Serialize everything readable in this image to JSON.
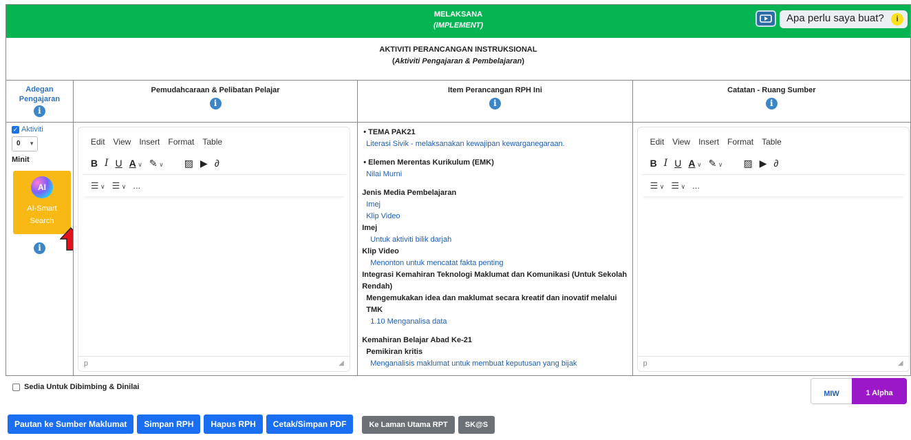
{
  "header": {
    "title": "MELAKSANA",
    "subtitle": "(IMPLEMENT)",
    "help_label": "Apa perlu saya buat?",
    "help_badge": "i"
  },
  "section": {
    "title": "AKTIVITI PERANCANGAN INSTRUKSIONAL",
    "subtitle_open": "(",
    "subtitle_italic": "Aktiviti Pengajaran & Pembelajaran",
    "subtitle_close": ")"
  },
  "columns": {
    "col1_line1": "Adegan",
    "col1_line2": "Pengajaran",
    "col2": "Pemudahcaraan & Pelibatan Pelajar",
    "col3": "Item Perancangan RPH Ini",
    "col4": "Catatan - Ruang Sumber",
    "info_glyph": "i"
  },
  "left_panel": {
    "aktiviti_label": "Aktiviti",
    "aktiviti_checked": true,
    "minute_value": "0",
    "minit_label": "Minit",
    "ai_logo_text": "AI",
    "ai_line1": "AI-Smart",
    "ai_line2": "Search"
  },
  "editor": {
    "menu": [
      "Edit",
      "View",
      "Insert",
      "Format",
      "Table"
    ],
    "status_text": "p",
    "more": "..."
  },
  "rph_items": [
    {
      "text": "TEMA PAK21",
      "style": "bullet-bold"
    },
    {
      "text": "Literasi Sivik - melaksanakan kewajipan kewarganegaraan.",
      "style": "link"
    },
    {
      "text": "",
      "style": "gap"
    },
    {
      "text": "Elemen Merentas Kurikulum (EMK)",
      "style": "bullet-bold"
    },
    {
      "text": "Nilai Murni",
      "style": "link"
    },
    {
      "text": "",
      "style": "gap"
    },
    {
      "text": "Jenis Media Pembelajaran",
      "style": "bold"
    },
    {
      "text": "Imej",
      "style": "link"
    },
    {
      "text": "Klip Video",
      "style": "link"
    },
    {
      "text": "Imej",
      "style": "bold"
    },
    {
      "text": "Untuk aktiviti bilik darjah",
      "style": "link-indent"
    },
    {
      "text": "Klip Video",
      "style": "bold"
    },
    {
      "text": "Menonton untuk mencatat fakta penting",
      "style": "link-indent"
    },
    {
      "text": "Integrasi Kemahiran Teknologi Maklumat dan Komunikasi (Untuk Sekolah Rendah)",
      "style": "bold"
    },
    {
      "text": "Mengemukakan idea dan maklumat secara kreatif dan inovatif melalui TMK",
      "style": "bold-indent"
    },
    {
      "text": "1.10 Menganalisa data",
      "style": "link-indent"
    },
    {
      "text": "",
      "style": "gap"
    },
    {
      "text": "Kemahiran Belajar Abad Ke-21",
      "style": "bold"
    },
    {
      "text": "Pemikiran kritis",
      "style": "bold-indent"
    },
    {
      "text": "Menganalisis maklumat untuk membuat keputusan yang bijak",
      "style": "link-indent"
    }
  ],
  "footer": {
    "ready_label": "Sedia Untuk Dibimbing & Dinilai",
    "tab_miw": "MIW",
    "tab_alpha": "1 Alpha"
  },
  "buttons": {
    "pautan": "Pautan ke Sumber Maklumat",
    "simpan": "Simpan RPH",
    "hapus": "Hapus RPH",
    "cetak": "Cetak/Simpan PDF",
    "laman": "Ke Laman Utama RPT",
    "skas": "SK@S"
  }
}
